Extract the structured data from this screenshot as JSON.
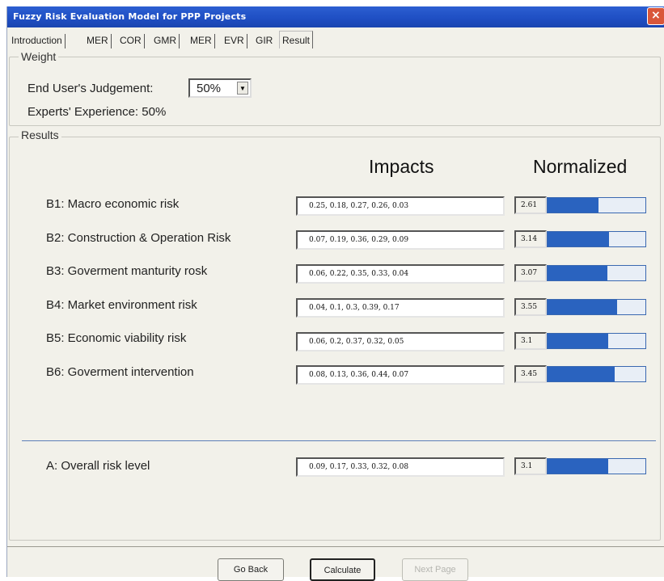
{
  "window": {
    "title": "Fuzzy Risk Evaluation Model for PPP Projects",
    "close_label": "×"
  },
  "tabs": [
    {
      "label": "Introduction"
    },
    {
      "label": "MER"
    },
    {
      "label": "COR"
    },
    {
      "label": "GMR"
    },
    {
      "label": "MER"
    },
    {
      "label": "EVR"
    },
    {
      "label": "GIR"
    },
    {
      "label": "Result",
      "active": true
    }
  ],
  "weight": {
    "group_label": "Weight",
    "end_user_label": "End User's Judgement:",
    "end_user_value": "50%",
    "experts_label": "Experts' Experience: 50%"
  },
  "results": {
    "group_label": "Results",
    "impacts_header": "Impacts",
    "normalized_header": "Normalized",
    "max_scale": 5,
    "rows": [
      {
        "label": "B1: Macro economic risk",
        "impacts": "0.25, 0.18, 0.27, 0.26, 0.03",
        "normalized": "2.61",
        "level": 2.61
      },
      {
        "label": "B2: Construction & Operation Risk",
        "impacts": "0.07, 0.19, 0.36, 0.29, 0.09",
        "normalized": "3.14",
        "level": 3.14
      },
      {
        "label": "B3: Goverment manturity rosk",
        "impacts": "0.06, 0.22, 0.35, 0.33, 0.04",
        "normalized": "3.07",
        "level": 3.07
      },
      {
        "label": "B4: Market environment risk",
        "impacts": "0.04, 0.1, 0.3, 0.39, 0.17",
        "normalized": "3.55",
        "level": 3.55
      },
      {
        "label": "B5: Economic viability risk",
        "impacts": "0.06, 0.2, 0.37, 0.32, 0.05",
        "normalized": "3.1",
        "level": 3.1
      },
      {
        "label": "B6: Goverment intervention",
        "impacts": "0.08, 0.13, 0.36, 0.44, 0.07",
        "normalized": "3.45",
        "level": 3.45
      }
    ],
    "overall": {
      "label": "A: Overall risk level",
      "impacts": "0.09, 0.17, 0.33, 0.32, 0.08",
      "normalized": "3.1",
      "level": 3.1
    }
  },
  "buttons": {
    "go_back": "Go Back",
    "calculate": "Calculate",
    "next_page": "Next Page"
  },
  "colors": {
    "title_bar": "#1f4fc4",
    "bar_fill": "#2a63bf",
    "close_button": "#d9573a"
  }
}
